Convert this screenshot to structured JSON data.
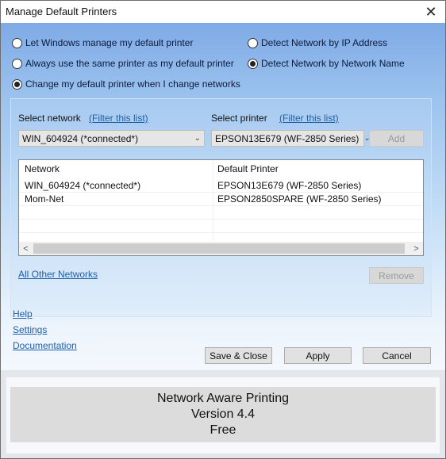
{
  "window": {
    "title": "Manage Default Printers",
    "close_icon": "close-icon"
  },
  "mode_options": [
    {
      "label": "Let Windows manage my default printer",
      "selected": false
    },
    {
      "label": "Always use the same printer as my default printer",
      "selected": false
    },
    {
      "label": "Change my default printer when I change networks",
      "selected": true
    }
  ],
  "detect_options": [
    {
      "label": "Detect Network by IP Address",
      "selected": false
    },
    {
      "label": "Detect Network by Network Name",
      "selected": true
    }
  ],
  "network_select": {
    "label": "Select network",
    "filter_link": "(Filter this list)",
    "value": "WIN_604924 (*connected*)"
  },
  "printer_select": {
    "label": "Select printer",
    "filter_link": "(Filter this list)",
    "value": "EPSON13E679 (WF-2850 Series)"
  },
  "add_button": {
    "label": "Add",
    "enabled": false
  },
  "table": {
    "columns": [
      "Network",
      "Default Printer"
    ],
    "rows": [
      [
        "WIN_604924 (*connected*)",
        "EPSON13E679 (WF-2850 Series)"
      ],
      [
        "Mom-Net",
        "EPSON2850SPARE (WF-2850 Series)"
      ]
    ],
    "scroll_left_icon": "<",
    "scroll_right_icon": ">"
  },
  "all_other_networks_link": "All Other Networks",
  "remove_button": {
    "label": "Remove",
    "enabled": false
  },
  "links": {
    "help": "Help",
    "settings": "Settings",
    "documentation": "Documentation"
  },
  "buttons": {
    "save_close": "Save & Close",
    "apply": "Apply",
    "cancel": "Cancel"
  },
  "footer": {
    "product": "Network Aware Printing",
    "version": "Version 4.4",
    "edition": "Free"
  }
}
